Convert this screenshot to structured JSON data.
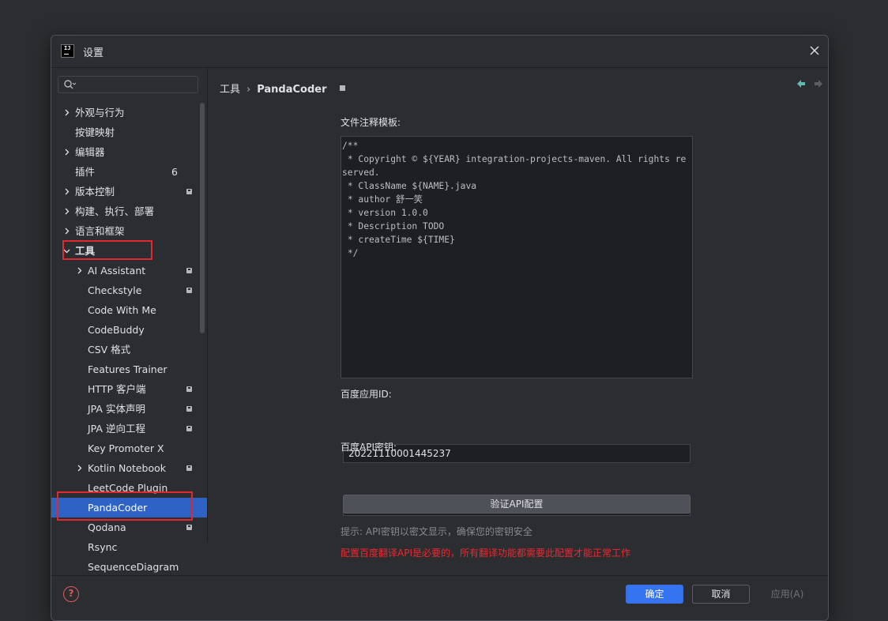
{
  "dialog": {
    "title": "设置"
  },
  "search": {
    "placeholder": ""
  },
  "tree": {
    "items": [
      {
        "label": "外观与行为",
        "expandable": true,
        "level": 0
      },
      {
        "label": "按键映射",
        "expandable": false,
        "level": 0
      },
      {
        "label": "编辑器",
        "expandable": true,
        "level": 0
      },
      {
        "label": "插件",
        "expandable": false,
        "level": 0,
        "count": "6"
      },
      {
        "label": "版本控制",
        "expandable": true,
        "level": 0,
        "lock": true
      },
      {
        "label": "构建、执行、部署",
        "expandable": true,
        "level": 0
      },
      {
        "label": "语言和框架",
        "expandable": true,
        "level": 0
      },
      {
        "label": "工具",
        "expandable": true,
        "expanded": true,
        "level": 0
      },
      {
        "label": "AI Assistant",
        "expandable": true,
        "level": 1,
        "lock": true
      },
      {
        "label": "Checkstyle",
        "expandable": false,
        "level": 1,
        "lock": true
      },
      {
        "label": "Code With Me",
        "expandable": false,
        "level": 1
      },
      {
        "label": "CodeBuddy",
        "expandable": false,
        "level": 1
      },
      {
        "label": "CSV 格式",
        "expandable": false,
        "level": 1
      },
      {
        "label": "Features Trainer",
        "expandable": false,
        "level": 1
      },
      {
        "label": "HTTP 客户端",
        "expandable": false,
        "level": 1,
        "lock": true
      },
      {
        "label": "JPA 实体声明",
        "expandable": false,
        "level": 1,
        "lock": true
      },
      {
        "label": "JPA 逆向工程",
        "expandable": false,
        "level": 1,
        "lock": true
      },
      {
        "label": "Key Promoter X",
        "expandable": false,
        "level": 1
      },
      {
        "label": "Kotlin Notebook",
        "expandable": true,
        "level": 1,
        "lock": true
      },
      {
        "label": "LeetCode Plugin",
        "expandable": false,
        "level": 1
      },
      {
        "label": "PandaCoder",
        "expandable": false,
        "level": 1,
        "selected": true
      },
      {
        "label": "Qodana",
        "expandable": false,
        "level": 1,
        "lock": true
      },
      {
        "label": "Rsync",
        "expandable": false,
        "level": 1
      },
      {
        "label": "SequenceDiagram",
        "expandable": false,
        "level": 1
      }
    ]
  },
  "breadcrumb": {
    "root": "工具",
    "separator": "›",
    "current": "PandaCoder"
  },
  "form": {
    "template_label": "文件注释模板:",
    "template_value": "/**\n * Copyright © ${YEAR} integration-projects-maven. All rights reserved.\n * ClassName ${NAME}.java\n * author 舒一笑\n * version 1.0.0\n * Description TODO\n * createTime ${TIME}\n */",
    "app_id_label": "百度应用ID:",
    "app_id_value": "20221110001445237",
    "api_key_label": "百度API密钥:",
    "api_key_value": "••••••••••••••••••••",
    "verify_button": "验证API配置",
    "hint": "提示: API密钥以密文显示，确保您的密钥安全",
    "warning": "配置百度翻译API是必要的，所有翻译功能都需要此配置才能正常工作"
  },
  "footer": {
    "help_icon": "?",
    "ok_label": "确定",
    "cancel_label": "取消",
    "apply_label": "应用(A)"
  },
  "colors": {
    "selection": "#2e63c5",
    "primary_button": "#3574f0",
    "warning_text": "#f0272f",
    "highlight_box": "#e0282f"
  }
}
